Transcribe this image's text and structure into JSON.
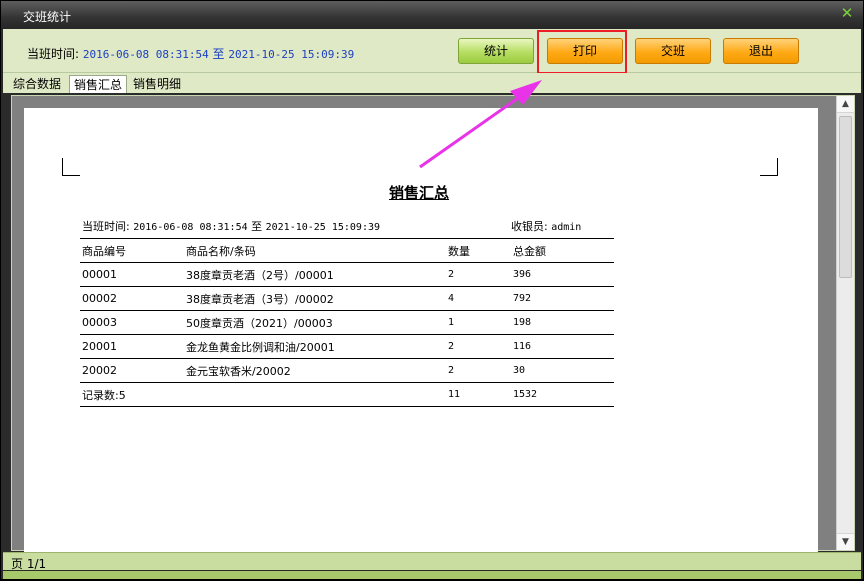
{
  "window": {
    "title": "交班统计",
    "close_icon": "close-icon"
  },
  "toolbar": {
    "shift_time_label": "当班时间:",
    "shift_start": "2016-06-08 08:31:54",
    "shift_sep": "至",
    "shift_end": "2021-10-25 15:09:39",
    "buttons": {
      "stat": "统计",
      "print": "打印",
      "handover": "交班",
      "exit": "退出"
    }
  },
  "tabs": [
    {
      "label": "综合数据",
      "active": false
    },
    {
      "label": "销售汇总",
      "active": true
    },
    {
      "label": "销售明细",
      "active": false
    }
  ],
  "report": {
    "title": "销售汇总",
    "meta_label": "当班时间:",
    "meta_start": "2016-06-08 08:31:54",
    "meta_sep": "至",
    "meta_end": "2021-10-25 15:09:39",
    "cashier_label": "收银员:",
    "cashier": "admin",
    "columns": [
      "商品编号",
      "商品名称/条码",
      "数量",
      "总金额"
    ],
    "rows": [
      [
        "00001",
        "38度章贡老酒（2号）/00001",
        "2",
        "396"
      ],
      [
        "00002",
        "38度章贡老酒（3号）/00002",
        "4",
        "792"
      ],
      [
        "00003",
        "50度章贡酒（2021）/00003",
        "1",
        "198"
      ],
      [
        "20001",
        "金龙鱼黄金比例调和油/20001",
        "2",
        "116"
      ],
      [
        "20002",
        "金元宝软香米/20002",
        "2",
        "30"
      ]
    ],
    "footer": [
      "记录数:5",
      "",
      "11",
      "1532"
    ]
  },
  "status": {
    "page_text": "页 1/1"
  },
  "colors": {
    "highlight": "#ee1c24",
    "arrow": "#e833e8",
    "accent_green": "#b6de62",
    "accent_orange": "#ffaa16"
  }
}
